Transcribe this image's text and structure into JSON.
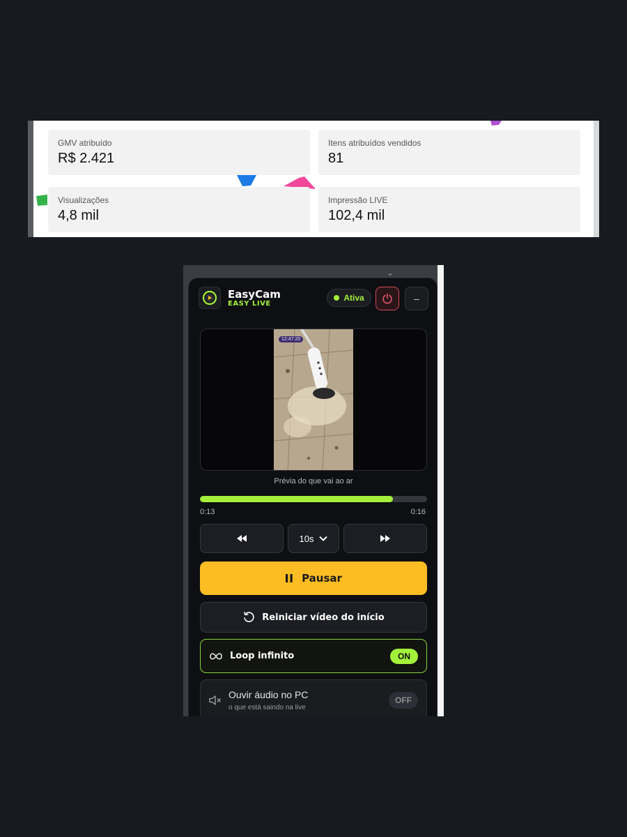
{
  "stats": [
    {
      "label": "GMV atribuído",
      "value": "R$ 2.421"
    },
    {
      "label": "Itens atribuídos vendidos",
      "value": "81"
    },
    {
      "label": "Visualizações",
      "value": "4,8 mil"
    },
    {
      "label": "Impressão LIVE",
      "value": "102,4 mil"
    }
  ],
  "widget": {
    "brand": {
      "name": "EasyCam",
      "subtitle": "EASY LIVE"
    },
    "status": {
      "label": "Ativa",
      "color": "#a3f03a"
    },
    "preview": {
      "timestamp": "12:47:20",
      "caption": "Prévia do que vai ao ar"
    },
    "playback": {
      "progress": 0.85,
      "current": "0:13",
      "total": "0:16"
    },
    "controls": {
      "skip_value": "10s",
      "pause_label": "Pausar",
      "restart_label": "Reiniciar vídeo do início"
    },
    "loop": {
      "label": "Loop infinito",
      "state": "ON"
    },
    "audio": {
      "label": "Ouvir áudio no PC",
      "sublabel": "o que está saindo na live",
      "state": "OFF"
    }
  },
  "colors": {
    "accent": "#a3f03a",
    "pause": "#fbbd23",
    "power": "#d24a5a"
  }
}
